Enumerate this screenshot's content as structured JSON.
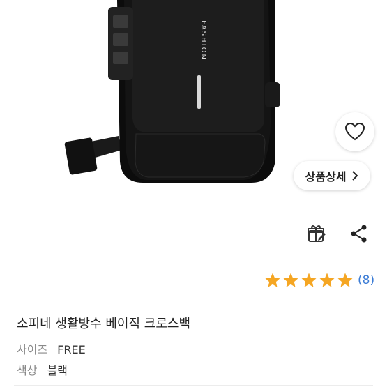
{
  "product_image": {
    "brand_text": "FASHION"
  },
  "wish_button": {
    "icon": "heart-icon"
  },
  "detail_button": {
    "label": "상품상세",
    "icon": "chevron-right-icon"
  },
  "actions": {
    "gift_icon": "gift-icon",
    "share_icon": "share-icon"
  },
  "rating": {
    "stars": 5,
    "count_label": "(8)",
    "star_color": "#f5a623"
  },
  "product": {
    "title": "소피네 생활방수 베이직 크로스백",
    "size_label": "사이즈",
    "size_value": "FREE",
    "color_label": "색상",
    "color_value": "블랙"
  },
  "colors": {
    "accent": "#3a7bd5",
    "star": "#f5a623"
  }
}
